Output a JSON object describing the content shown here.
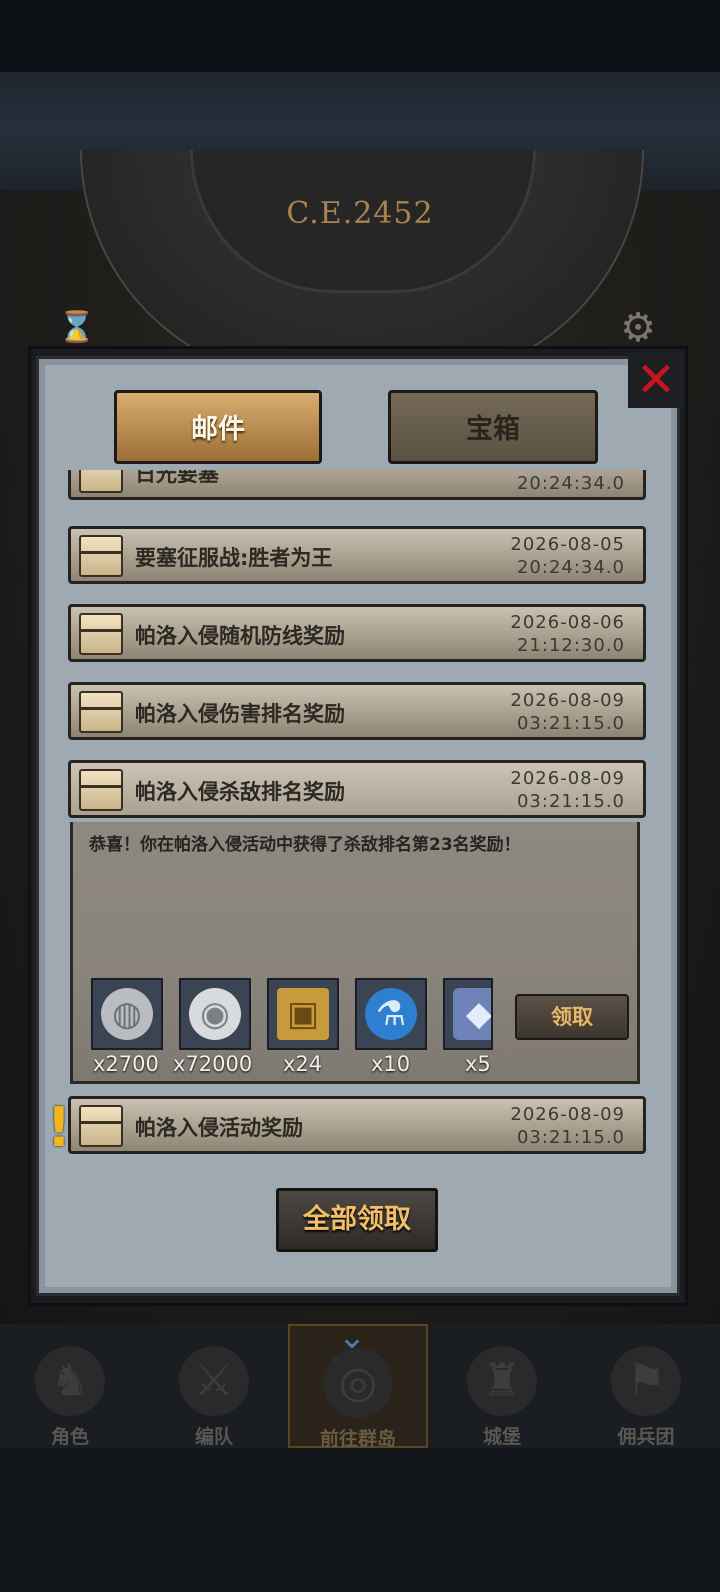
{
  "scene": {
    "year_label": "C.E.2452",
    "gear_icon": "gear-icon",
    "hourglass_icon": "hourglass-icon"
  },
  "tabs": [
    {
      "label": "邮件",
      "selected": true
    },
    {
      "label": "宝箱",
      "selected": false
    }
  ],
  "mails": [
    {
      "title": "日光要塞",
      "date": "",
      "time": "20:24:34.0",
      "icon": "chest-icon"
    },
    {
      "title": "要塞征服战:胜者为王",
      "date": "2026-08-05",
      "time": "20:24:34.0",
      "icon": "open-chest-icon"
    },
    {
      "title": "帕洛入侵随机防线奖励",
      "date": "2026-08-06",
      "time": "21:12:30.0",
      "icon": "chest-icon"
    },
    {
      "title": "帕洛入侵伤害排名奖励",
      "date": "2026-08-09",
      "time": "03:21:15.0",
      "icon": "chest-icon"
    },
    {
      "title": "帕洛入侵杀敌排名奖励",
      "date": "2026-08-09",
      "time": "03:21:15.0",
      "icon": "chest-icon",
      "expanded": true
    },
    {
      "title": "帕洛入侵活动奖励",
      "date": "2026-08-09",
      "time": "03:21:15.0",
      "icon": "chest-icon",
      "unread": true
    }
  ],
  "detail": {
    "message": "恭喜！你在帕洛入侵活动中获得了杀敌排名第23名奖励！",
    "rewards": [
      {
        "name": "silver-coin-icon",
        "count": "x2700"
      },
      {
        "name": "silver-medal-icon",
        "count": "x72000"
      },
      {
        "name": "treasure-chest-icon",
        "count": "x24"
      },
      {
        "name": "potion-icon",
        "count": "x10"
      },
      {
        "name": "crystal-icon",
        "count": "x5"
      }
    ],
    "claim_label": "领取"
  },
  "claim_all_label": "全部领取",
  "bottom_nav": [
    {
      "label": "角色",
      "icon": "character-icon"
    },
    {
      "label": "编队",
      "icon": "formation-icon"
    },
    {
      "label": "前往群岛",
      "icon": "globe-icon",
      "active": true
    },
    {
      "label": "城堡",
      "icon": "castle-icon"
    },
    {
      "label": "佣兵团",
      "icon": "mercenary-icon"
    }
  ]
}
